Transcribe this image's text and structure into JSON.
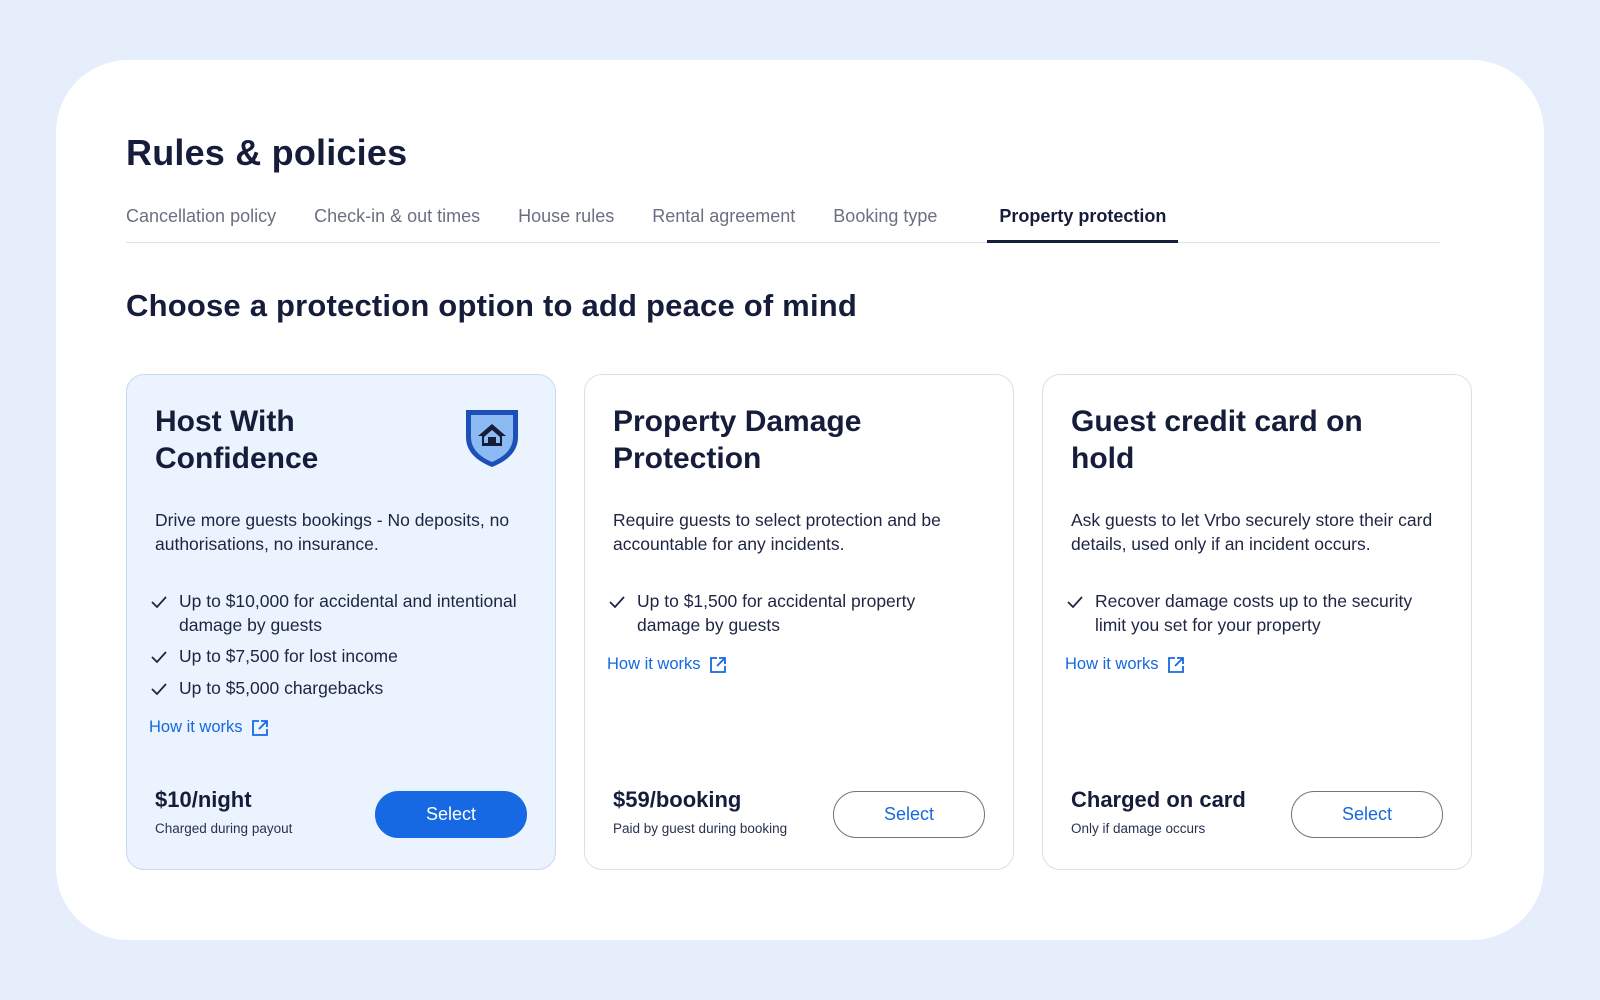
{
  "page": {
    "title": "Rules & policies",
    "tabs": [
      {
        "label": "Cancellation policy"
      },
      {
        "label": "Check-in & out times"
      },
      {
        "label": "House rules"
      },
      {
        "label": "Rental agreement"
      },
      {
        "label": "Booking type"
      },
      {
        "label": "Property protection",
        "active": true
      }
    ],
    "section_title": "Choose a protection option to add peace of mind"
  },
  "cards": [
    {
      "title": "Host With Confidence",
      "icon": "shield-house-icon",
      "description": "Drive more guests bookings - No deposits, no authorisations, no insurance.",
      "features": [
        "Up to $10,000 for accidental and intentional damage by guests",
        "Up to $7,500 for lost income",
        "Up to $5,000 chargebacks"
      ],
      "link_label": "How it works",
      "price": "$10/night",
      "price_note": "Charged during payout",
      "button_label": "Select",
      "selected_style": "primary"
    },
    {
      "title": "Property Damage Protection",
      "description": "Require guests to select protection and be accountable for any incidents.",
      "features": [
        "Up to $1,500 for accidental property damage by guests"
      ],
      "link_label": "How it works",
      "price": "$59/booking",
      "price_note": "Paid by guest during booking",
      "button_label": "Select",
      "selected_style": "outline"
    },
    {
      "title": "Guest credit card on hold",
      "description": "Ask guests to let Vrbo securely store their card details, used only if an incident occurs.",
      "features": [
        "Recover damage costs up to the security limit you set for your property"
      ],
      "link_label": "How it works",
      "price": "Charged on card",
      "price_note": "Only if damage occurs",
      "button_label": "Select",
      "selected_style": "outline"
    }
  ],
  "colors": {
    "background": "#e6eefb",
    "panel": "#ffffff",
    "accent": "#1668e3",
    "text_dark": "#161d3a",
    "featured_card": "#eaf3fe"
  }
}
